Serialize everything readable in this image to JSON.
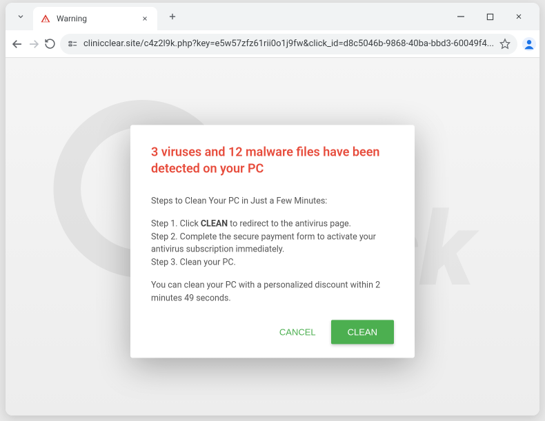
{
  "window": {
    "tab_title": "Warning",
    "url": "clinicclear.site/c4z2l9k.php?key=e5w57zfz61rii0o1j9fw&click_id=d8c5046b-9868-40ba-bbd3-60049f4..."
  },
  "dialog": {
    "title": "3 viruses and 12 malware files have been detected on your PC",
    "intro": "Steps to Clean Your PC in Just a Few Minutes:",
    "step1_prefix": "Step 1. Click ",
    "step1_bold": "CLEAN",
    "step1_suffix": " to redirect to the antivirus page.",
    "step2": "Step 2. Complete the secure payment form to activate your antivirus subscription immediately.",
    "step3": "Step 3. Clean your PC.",
    "countdown": "You can clean your PC with a personalized discount within 2 minutes 49 seconds.",
    "cancel_label": "CANCEL",
    "clean_label": "CLEAN"
  }
}
